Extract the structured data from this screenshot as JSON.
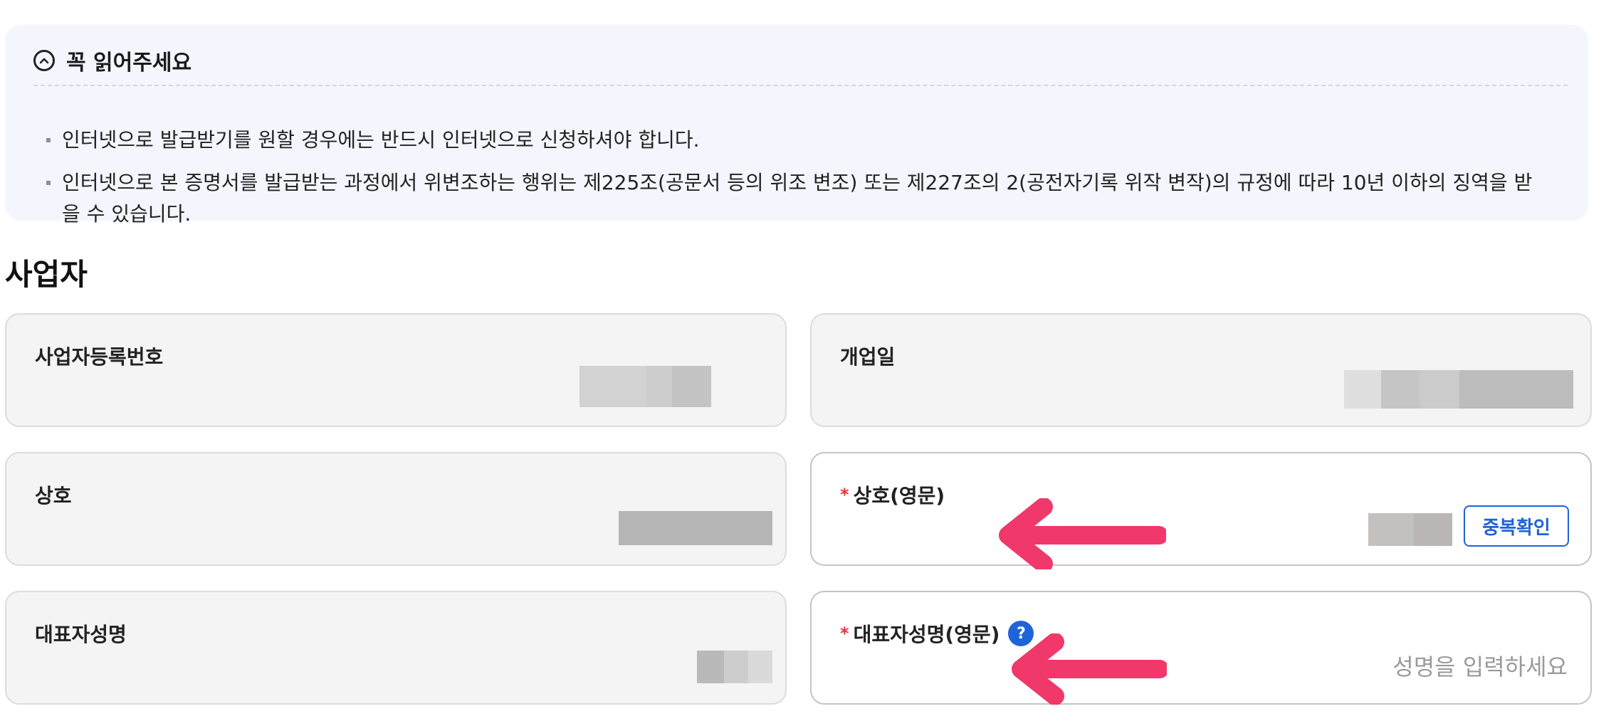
{
  "notice": {
    "title": "꼭 읽어주세요",
    "icon": "chevron-up-circle-icon",
    "items": [
      "인터넷으로 발급받기를 원할 경우에는 반드시 인터넷으로 신청하셔야 합니다.",
      "인터넷으로 본 증명서를 발급받는 과정에서 위변조하는 행위는 제225조(공문서 등의 위조 변조) 또는 제227조의 2(공전자기록 위작 변작)의 규정에 따라 10년 이하의 징역을 받을 수 있습니다."
    ]
  },
  "section": {
    "title": "사업자"
  },
  "fields": {
    "business_reg_no": {
      "label": "사업자등록번호"
    },
    "open_date": {
      "label": "개업일"
    },
    "company_name": {
      "label": "상호"
    },
    "company_name_en": {
      "label": "상호(영문)",
      "required_mark": "*",
      "dup_check_label": "중복확인"
    },
    "ceo_name": {
      "label": "대표자성명"
    },
    "ceo_name_en": {
      "label": "대표자성명(영문)",
      "required_mark": "*",
      "help_label": "?",
      "placeholder": "성명을 입력하세요"
    }
  },
  "colors": {
    "accent": "#1f63d8",
    "required": "#e8333d",
    "arrow": "#f0386b",
    "notice_bg": "#f3f6fc",
    "readonly_bg": "#f4f4f4"
  }
}
